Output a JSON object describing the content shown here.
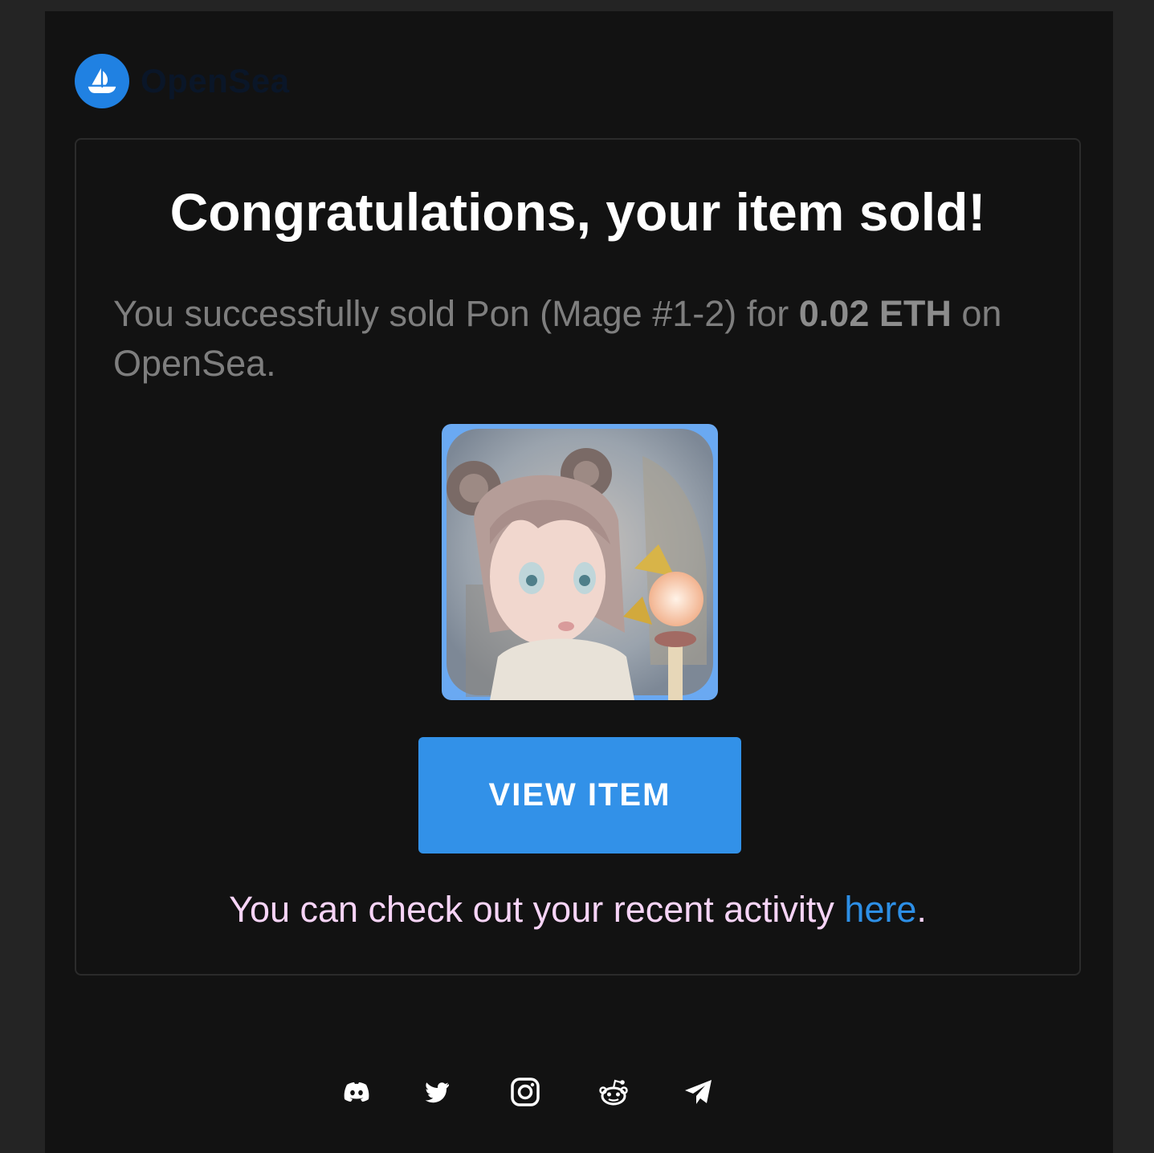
{
  "brand": {
    "name": "OpenSea",
    "accent": "#2081e2"
  },
  "card": {
    "title": "Congratulations, your item sold!",
    "message_prefix": "You successfully sold Pon (Mage #1-2) for ",
    "price": "0.02 ETH",
    "message_suffix": " on OpenSea.",
    "item_image_alt": "Pon (Mage #1-2)",
    "button_label": "VIEW ITEM",
    "activity_prefix": "You can check out your recent activity ",
    "activity_link": "here",
    "activity_suffix": "."
  },
  "footer": {
    "socials": [
      {
        "name": "discord-icon"
      },
      {
        "name": "twitter-icon"
      },
      {
        "name": "instagram-icon"
      },
      {
        "name": "reddit-icon"
      },
      {
        "name": "telegram-icon"
      }
    ]
  },
  "colors": {
    "button": "#3291e8",
    "link": "#2d8fe6",
    "activity_text": "#f7d4f7"
  }
}
